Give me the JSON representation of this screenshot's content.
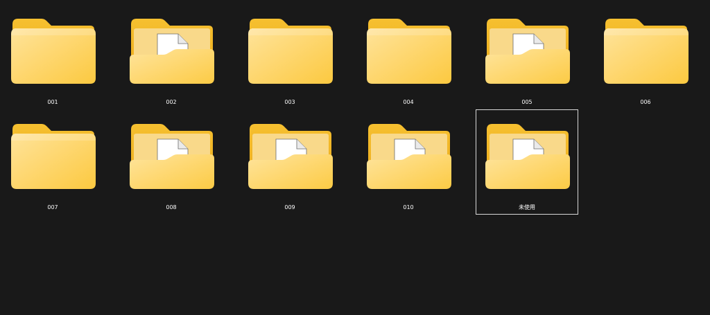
{
  "explorer": {
    "folders": [
      {
        "label": "001",
        "icon": "folder-icon",
        "selected": false
      },
      {
        "label": "002",
        "icon": "folder-with-document-icon",
        "selected": false
      },
      {
        "label": "003",
        "icon": "folder-icon",
        "selected": false
      },
      {
        "label": "004",
        "icon": "folder-icon",
        "selected": false
      },
      {
        "label": "005",
        "icon": "folder-with-document-icon",
        "selected": false
      },
      {
        "label": "006",
        "icon": "folder-icon",
        "selected": false
      },
      {
        "label": "007",
        "icon": "folder-icon",
        "selected": false
      },
      {
        "label": "008",
        "icon": "folder-with-document-icon",
        "selected": false
      },
      {
        "label": "009",
        "icon": "folder-with-document-icon",
        "selected": false
      },
      {
        "label": "010",
        "icon": "folder-with-document-icon",
        "selected": false
      },
      {
        "label": "未使用",
        "icon": "folder-with-document-icon",
        "selected": true
      }
    ]
  },
  "colors": {
    "background": "#191919",
    "folder_back": "#f2b822",
    "folder_front": "#fdd46a",
    "selection_border": "#d9d9d9"
  }
}
